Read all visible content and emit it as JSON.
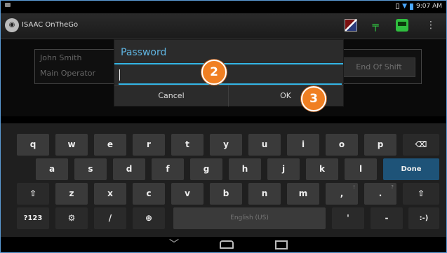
{
  "status_bar": {
    "time": "9:07 AM"
  },
  "app": {
    "title": "ISAAC OnTheGo"
  },
  "background": {
    "name": "John Smith",
    "role": "Main Operator",
    "end_shift_label": "End Of Shift"
  },
  "dialog": {
    "title": "Password",
    "password_value": "",
    "cancel_label": "Cancel",
    "ok_label": "OK"
  },
  "callouts": {
    "step_2": "2",
    "step_3": "3"
  },
  "keyboard": {
    "row1": [
      "q",
      "w",
      "e",
      "r",
      "t",
      "y",
      "u",
      "i",
      "o",
      "p"
    ],
    "row2": [
      "a",
      "s",
      "d",
      "f",
      "g",
      "h",
      "j",
      "k",
      "l"
    ],
    "row3": [
      "z",
      "x",
      "c",
      "v",
      "b",
      "n",
      "m",
      ",",
      "."
    ],
    "done_label": "Done",
    "symbols_label": "?123",
    "space_label": "English (US)",
    "smiley_label": ":-)",
    "slash_label": "/",
    "hints": {
      "comma": "!",
      "period": "?"
    },
    "icons": {
      "backspace": "backspace-icon",
      "shift": "shift-icon",
      "settings": "settings-icon",
      "globe": "globe-icon"
    }
  },
  "nav_icons": [
    "back-icon",
    "home-icon",
    "recent-apps-icon"
  ],
  "colors": {
    "accent": "#33b5e5",
    "callout": "#f07f22",
    "done": "#1e5378"
  }
}
